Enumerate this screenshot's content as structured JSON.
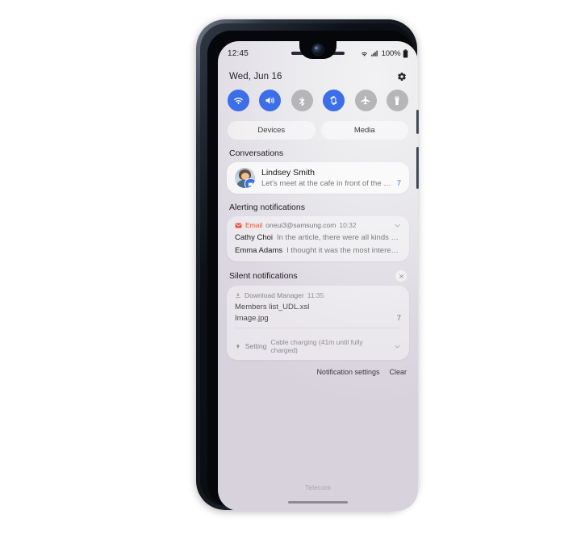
{
  "statusbar": {
    "time": "12:45",
    "wifi_icon": "wifi-icon",
    "signal_icon": "signal-bars-icon",
    "battery_percent": "100%",
    "battery_icon": "battery-full-icon"
  },
  "quick_panel": {
    "date": "Wed, Jun 16",
    "settings_icon": "gear-icon",
    "toggles": [
      {
        "name": "wifi",
        "icon": "wifi-icon",
        "state": "on"
      },
      {
        "name": "sound",
        "icon": "sound-icon",
        "state": "on"
      },
      {
        "name": "bluetooth",
        "icon": "bluetooth-icon",
        "state": "off"
      },
      {
        "name": "auto-rotate",
        "icon": "auto-rotate-icon",
        "state": "on"
      },
      {
        "name": "airplane",
        "icon": "airplane-icon",
        "state": "off"
      },
      {
        "name": "flashlight",
        "icon": "flashlight-icon",
        "state": "off"
      }
    ],
    "pills": [
      {
        "label": "Devices"
      },
      {
        "label": "Media"
      }
    ]
  },
  "conversations": {
    "title": "Conversations",
    "items": [
      {
        "name": "Lindsey Smith",
        "message": "Let's meet at the cafe in front of the coff...",
        "count": "7",
        "avatar_icon": "avatar",
        "badge_icon": "message-badge-icon"
      }
    ]
  },
  "alerting": {
    "title": "Alerting notifications",
    "app": "Email",
    "app_icon": "email-icon",
    "account": "oneui3@samsung.com",
    "time": "10:32",
    "expand_icon": "chevron-down-icon",
    "messages": [
      {
        "from": "Cathy Choi",
        "preview": "In the article, there were all kinds of wond..."
      },
      {
        "from": "Emma Adams",
        "preview": "I thought it was the most interesting th..."
      }
    ]
  },
  "silent": {
    "title": "Silent notifications",
    "close_icon": "close-icon",
    "download": {
      "app": "Download Manager",
      "app_icon": "download-icon",
      "time": "11:35",
      "file1": "Members list_UDL.xsl",
      "file2": "Image.jpg",
      "count": "7"
    },
    "setting": {
      "app": "Setting",
      "app_icon": "charging-bolt-icon",
      "text": "Cable charging (41m until fully charged)",
      "expand_icon": "chevron-down-icon"
    }
  },
  "actions": {
    "notification_settings": "Notification settings",
    "clear": "Clear"
  },
  "bottom": {
    "carrier": "Telecom",
    "nav_handle": "gesture-bar"
  },
  "colors": {
    "accent_blue": "#3b6ee8",
    "toggle_off_gray": "#b6b6b8",
    "email_red": "#e8553c"
  }
}
